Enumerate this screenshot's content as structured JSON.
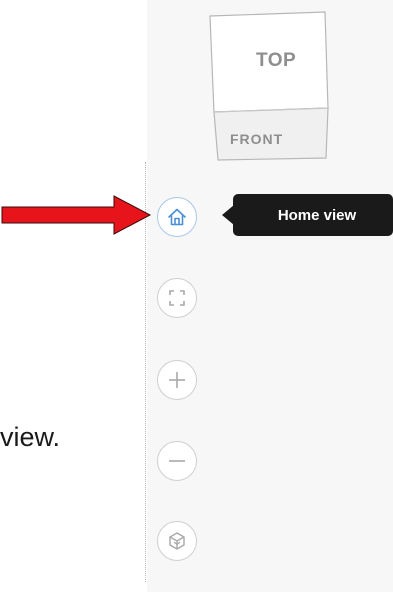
{
  "viewcube": {
    "top_label": "TOP",
    "front_label": "FRONT"
  },
  "nav_buttons": [
    {
      "name": "home-view-button",
      "icon": "home-icon",
      "active": true
    },
    {
      "name": "fit-to-view-button",
      "icon": "fit-view-icon",
      "active": false
    },
    {
      "name": "zoom-in-button",
      "icon": "plus-icon",
      "active": false
    },
    {
      "name": "zoom-out-button",
      "icon": "minus-icon",
      "active": false
    },
    {
      "name": "orbit-button",
      "icon": "orbit-cube-icon",
      "active": false
    }
  ],
  "tooltip": {
    "text": "Home view"
  },
  "annotation": {
    "arrow_color": "#e8141b",
    "partial_text": "view."
  },
  "colors": {
    "active_border": "#a9c7ea",
    "active_icon": "#4a8fd6",
    "inactive_border": "#cfcfcf",
    "inactive_icon": "#a8a8a8",
    "tooltip_bg": "#1a1a1a",
    "panel_bg": "#f7f7f7"
  }
}
